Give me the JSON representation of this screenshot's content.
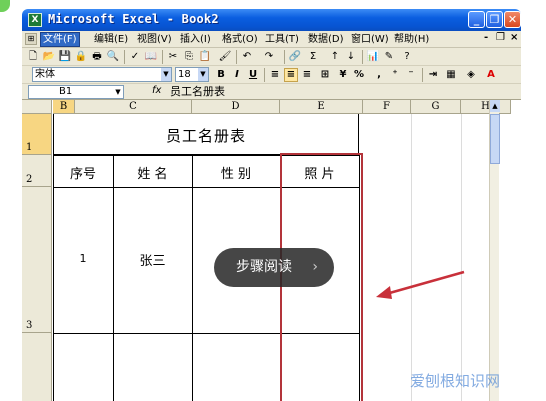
{
  "window": {
    "app_icon": "X",
    "title": "Microsoft Excel - Book2",
    "minimize_label": "_",
    "restore_label": "❐",
    "close_label": "✕"
  },
  "menu": {
    "items": [
      "文件(F)",
      "编辑(E)",
      "视图(V)",
      "插入(I)",
      "格式(O)",
      "工具(T)",
      "数据(D)",
      "窗口(W)",
      "帮助(H)"
    ],
    "doc_minimize": "- ",
    "doc_restore": "❐",
    "doc_close": "×"
  },
  "format_toolbar": {
    "font_name": "宋体",
    "font_size": "18",
    "bold": "B",
    "italic": "I",
    "underline": "U",
    "percent": "%",
    "comma": ","
  },
  "formula_bar": {
    "name_box": "B1",
    "fx": "fx",
    "content": "员工名册表"
  },
  "columns": [
    "B",
    "C",
    "D",
    "E",
    "F",
    "G",
    "H"
  ],
  "rows": [
    "1",
    "2",
    "3"
  ],
  "sheet": {
    "title": "员工名册表",
    "headers": [
      "序号",
      "姓 名",
      "性 别",
      "照 片"
    ],
    "row1": {
      "no": "1",
      "name": "张三"
    }
  },
  "overlay": {
    "label": "步骤阅读",
    "chevron": "›"
  },
  "watermark": "爱刨根知识网",
  "colors": {
    "titlebar": "#0754d2",
    "menubar": "#ece9d8",
    "selected_header": "#f7d682",
    "photo_frame": "#b3343a",
    "arrow": "#c8303a"
  }
}
